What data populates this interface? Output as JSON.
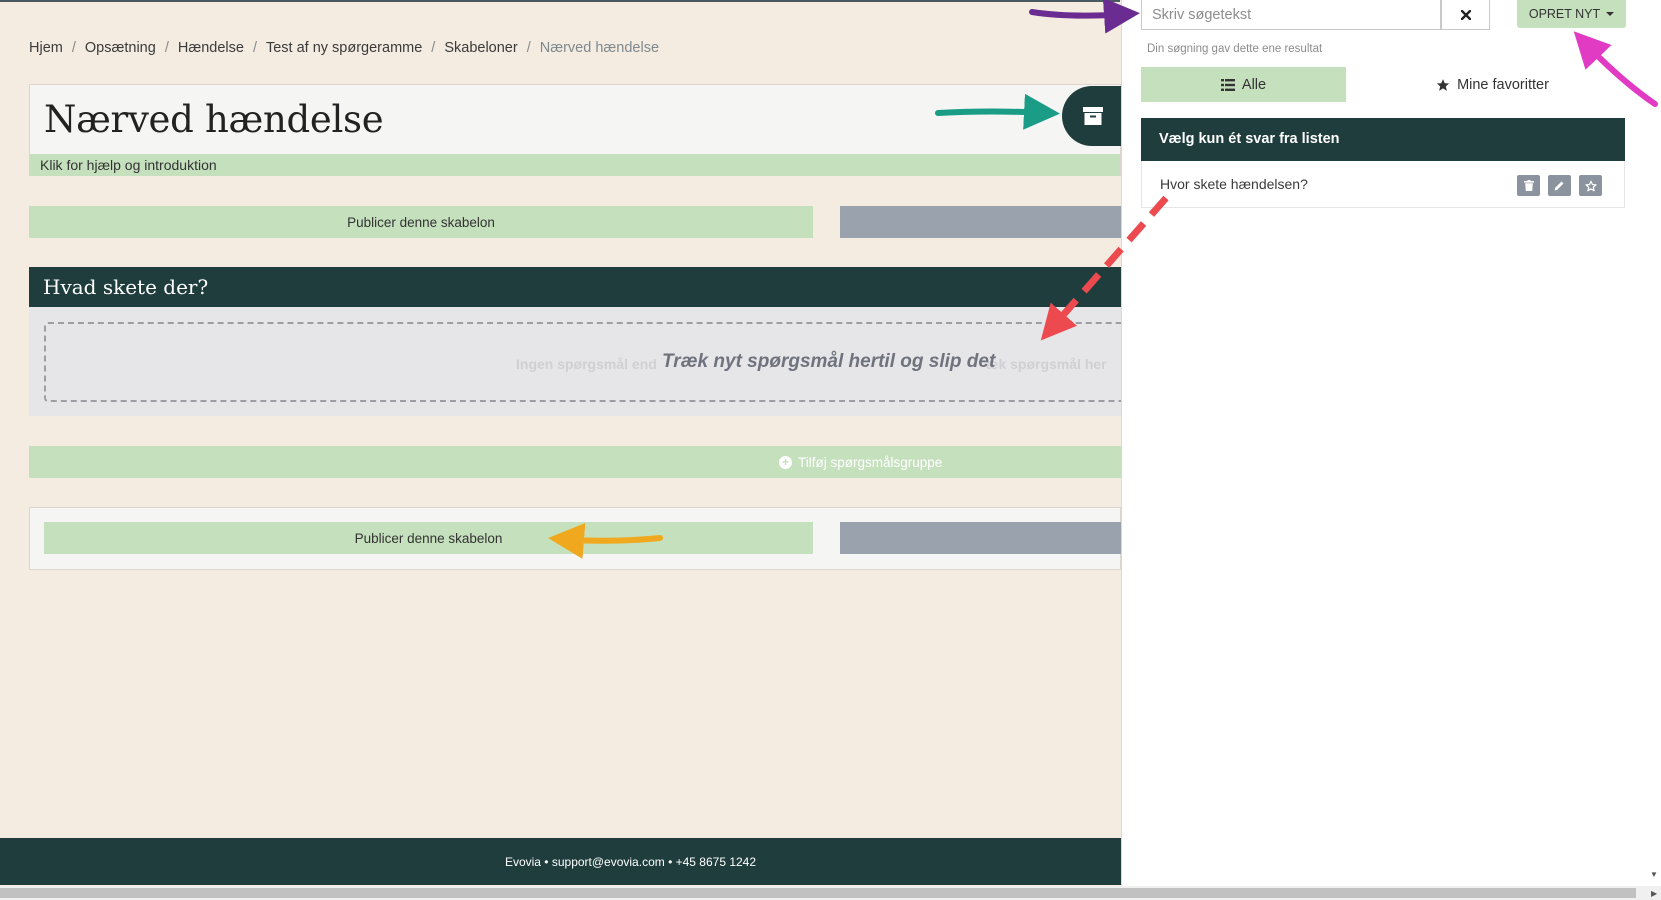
{
  "breadcrumb": {
    "items": [
      "Hjem",
      "Opsætning",
      "Hændelse",
      "Test af ny spørgeramme",
      "Skabeloner"
    ],
    "current": "Nærved hændelse"
  },
  "title_card": {
    "title": "Nærved hændelse",
    "help_text": "Klik for hjælp og introduktion",
    "archive_icon": "archive-box-icon"
  },
  "publish_label": "Publicer denne skabelon",
  "group": {
    "title": "Hvad skete der?",
    "drop_text": "Træk nyt spørgsmål hertil og slip det",
    "ghost_text_left": "Ingen spørgsmål end",
    "ghost_text_right": "æk spørgsmål her"
  },
  "add_group_label": "Tilføj spørgsmålsgruppe",
  "footer": {
    "text": "Evovia • support@evovia.com • +45 8675 1242"
  },
  "panel": {
    "search_placeholder": "Skriv søgetekst",
    "search_value": "",
    "new_button": "OPRET NYT",
    "result_text": "Din søgning gav dette ene resultat",
    "tabs": {
      "all": "Alle",
      "favorites": "Mine favoritter"
    },
    "list_header": "Vælg kun ét svar fra listen",
    "items": [
      {
        "label": "Hvor skete hændelsen?"
      }
    ]
  },
  "colors": {
    "dark_green": "#1f3d3d",
    "light_green": "#c5e0bd",
    "background": "#f4ebe1",
    "grey_button": "#9aa2ad"
  }
}
